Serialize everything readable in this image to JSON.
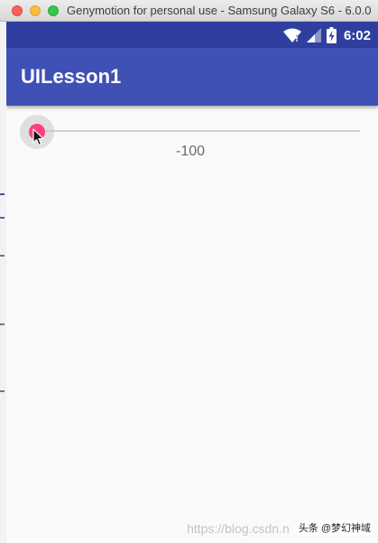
{
  "window": {
    "title": "Genymotion for personal use - Samsung Galaxy S6 - 6.0.0"
  },
  "statusbar": {
    "time": "6:02",
    "icons": [
      "wifi-icon",
      "signal-icon",
      "battery-charging-icon"
    ]
  },
  "app": {
    "title": "UILesson1"
  },
  "seekbar": {
    "value_label": "-100",
    "progress_fraction": 0,
    "accent_color": "#ff4081"
  },
  "colors": {
    "status_bar": "#303f9f",
    "app_bar": "#3f51b5",
    "accent": "#ff4081",
    "background": "#fafafa"
  },
  "watermark": {
    "url": "https://blog.csdn.n",
    "brand": "头条 @梦幻神域"
  }
}
